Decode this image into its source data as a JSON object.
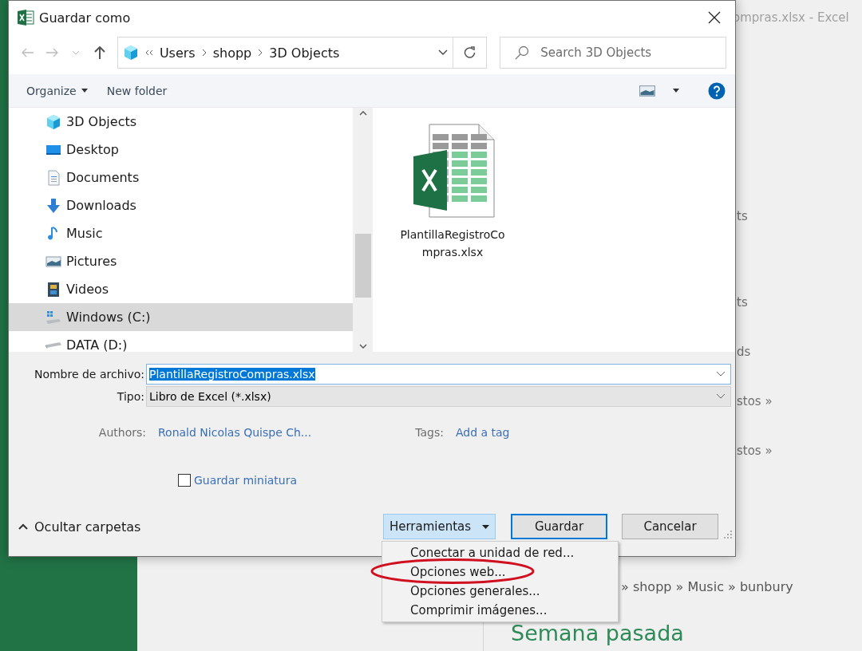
{
  "background": {
    "window_title": "ompras.xlsx - Excel",
    "fragments": [
      "ts",
      "ts",
      "ds",
      "stos »",
      "stos »"
    ],
    "path": "» shopp » Music » bunbury",
    "heading": "Semana pasada"
  },
  "dialog": {
    "title": "Guardar como",
    "breadcrumb": [
      "Users",
      "shopp",
      "3D Objects"
    ],
    "search": {
      "placeholder": "Search 3D Objects"
    },
    "toolbar": {
      "organize": "Organize",
      "new_folder": "New folder"
    },
    "nav": [
      {
        "label": "3D Objects",
        "kind": "cube",
        "selected": false
      },
      {
        "label": "Desktop",
        "kind": "desktop",
        "selected": false
      },
      {
        "label": "Documents",
        "kind": "document",
        "selected": false
      },
      {
        "label": "Downloads",
        "kind": "download",
        "selected": false
      },
      {
        "label": "Music",
        "kind": "music",
        "selected": false
      },
      {
        "label": "Pictures",
        "kind": "pictures",
        "selected": false
      },
      {
        "label": "Videos",
        "kind": "videos",
        "selected": false
      },
      {
        "label": "Windows (C:)",
        "kind": "system-drive",
        "selected": true
      },
      {
        "label": "DATA (D:)",
        "kind": "drive",
        "selected": false
      }
    ],
    "files": [
      {
        "name": "PlantillaRegistroCompras.xlsx",
        "kind": "excel"
      }
    ],
    "file_name": {
      "label": "Nombre de archivo:",
      "value": "PlantillaRegistroCompras.xlsx"
    },
    "file_type": {
      "label": "Tipo:",
      "value": "Libro de Excel (*.xlsx)"
    },
    "authors": {
      "label": "Authors:",
      "value": "Ronald Nicolas Quispe Ch..."
    },
    "tags": {
      "label": "Tags:",
      "value": "Add a tag"
    },
    "thumbnail": {
      "label": "Guardar miniatura",
      "checked": false
    },
    "hide_folders": "Ocultar carpetas",
    "tools": {
      "label": "Herramientas",
      "expanded": true
    },
    "save": {
      "label": "Guardar",
      "default": true
    },
    "cancel": {
      "label": "Cancelar"
    },
    "tools_menu": [
      {
        "label": "Conectar a unidad de red...",
        "circled": false
      },
      {
        "label": "Opciones web...",
        "circled": true
      },
      {
        "label": "Opciones generales...",
        "circled": false
      },
      {
        "label": "Comprimir imágenes...",
        "circled": false
      }
    ]
  }
}
